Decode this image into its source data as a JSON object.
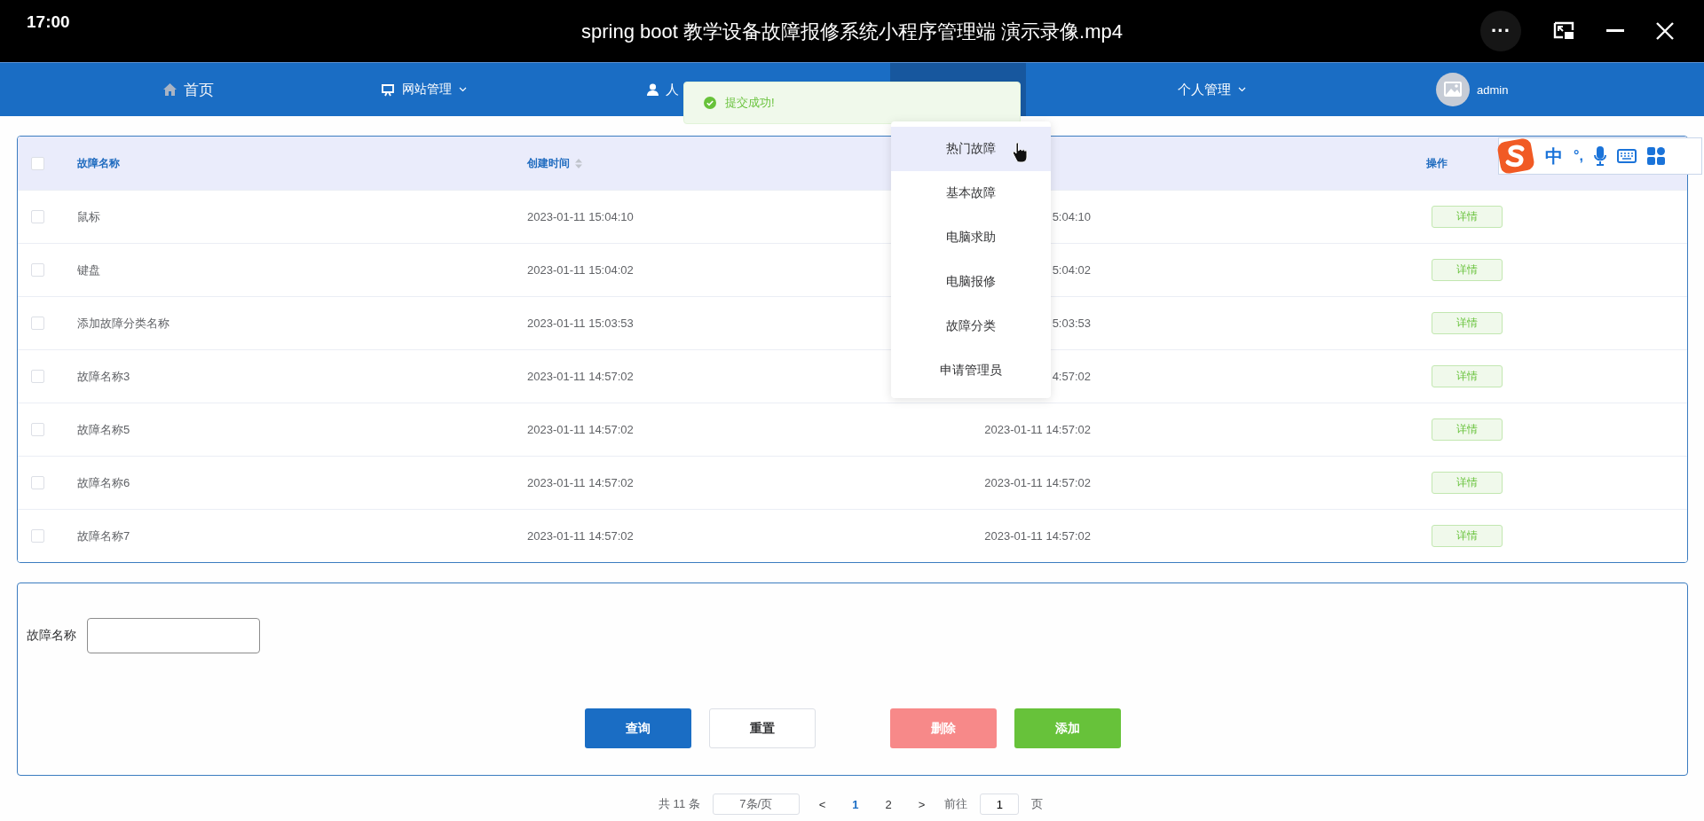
{
  "player": {
    "time": "17:00",
    "title": "spring boot 教学设备故障报修系统小程序管理端 演示录像.mp4",
    "more": "···"
  },
  "nav": {
    "items": [
      {
        "kind": "home",
        "label": "首页",
        "dropdown": false,
        "selected": false
      },
      {
        "kind": "screen",
        "label": "网站管理",
        "dropdown": true,
        "selected": false
      },
      {
        "kind": "user",
        "label": "人",
        "dropdown": false,
        "selected": false
      },
      {
        "selected": true
      },
      {
        "label": "个人管理",
        "dropdown": true,
        "selected": false
      },
      {
        "kind": "avatar",
        "label": "admin",
        "dropdown": false,
        "selected": false
      }
    ]
  },
  "toast": {
    "message": "提交成功!"
  },
  "dropdown_menu": [
    {
      "label": "热门故障",
      "selected": true
    },
    {
      "label": "基本故障",
      "selected": false
    },
    {
      "label": "电脑求助",
      "selected": false
    },
    {
      "label": "电脑报修",
      "selected": false
    },
    {
      "label": "故障分类",
      "selected": false
    },
    {
      "label": "申请管理员",
      "selected": false
    }
  ],
  "ime_toolbar": {
    "mode": "中",
    "punctuation": "°,"
  },
  "table": {
    "columns": [
      {
        "label": "故障名称"
      },
      {
        "label": "创建时间",
        "sortable": true
      },
      {},
      {
        "label": "操作"
      }
    ],
    "all_checked": false,
    "rows": [
      {
        "checked": false,
        "name": "鼠标",
        "created": "2023-01-11 15:04:10",
        "column_3": "5:04:10",
        "action": "详情"
      },
      {
        "checked": false,
        "name": "键盘",
        "created": "2023-01-11 15:04:02",
        "column_3": "5:04:02",
        "action": "详情"
      },
      {
        "checked": false,
        "name": "添加故障分类名称",
        "created": "2023-01-11 15:03:53",
        "column_3": "5:03:53",
        "action": "详情"
      },
      {
        "checked": false,
        "name": "故障名称3",
        "created": "2023-01-11 14:57:02",
        "column_3": "4:57:02",
        "action": "详情"
      },
      {
        "checked": false,
        "name": "故障名称5",
        "created": "2023-01-11 14:57:02",
        "column_3": "2023-01-11 14:57:02",
        "action": "详情"
      },
      {
        "checked": false,
        "name": "故障名称6",
        "created": "2023-01-11 14:57:02",
        "column_3": "2023-01-11 14:57:02",
        "action": "详情"
      },
      {
        "checked": false,
        "name": "故障名称7",
        "created": "2023-01-11 14:57:02",
        "column_3": "2023-01-11 14:57:02",
        "action": "详情"
      }
    ]
  },
  "search": {
    "label": "故障名称",
    "buttons": [
      {
        "kind": "primary",
        "label": "查询"
      },
      {
        "kind": "default",
        "label": "重置"
      },
      {
        "kind": "danger",
        "label": "删除"
      },
      {
        "kind": "success",
        "label": "添加"
      }
    ]
  },
  "pagination": {
    "total": "共 11 条",
    "page_size": "7条/页",
    "prev": "<",
    "pages": [
      {
        "label": "1",
        "selected": true
      },
      {
        "label": "2",
        "selected": false
      }
    ],
    "next": ">",
    "goto_label": "前往",
    "goto_value": "1",
    "goto_suffix": "页"
  }
}
